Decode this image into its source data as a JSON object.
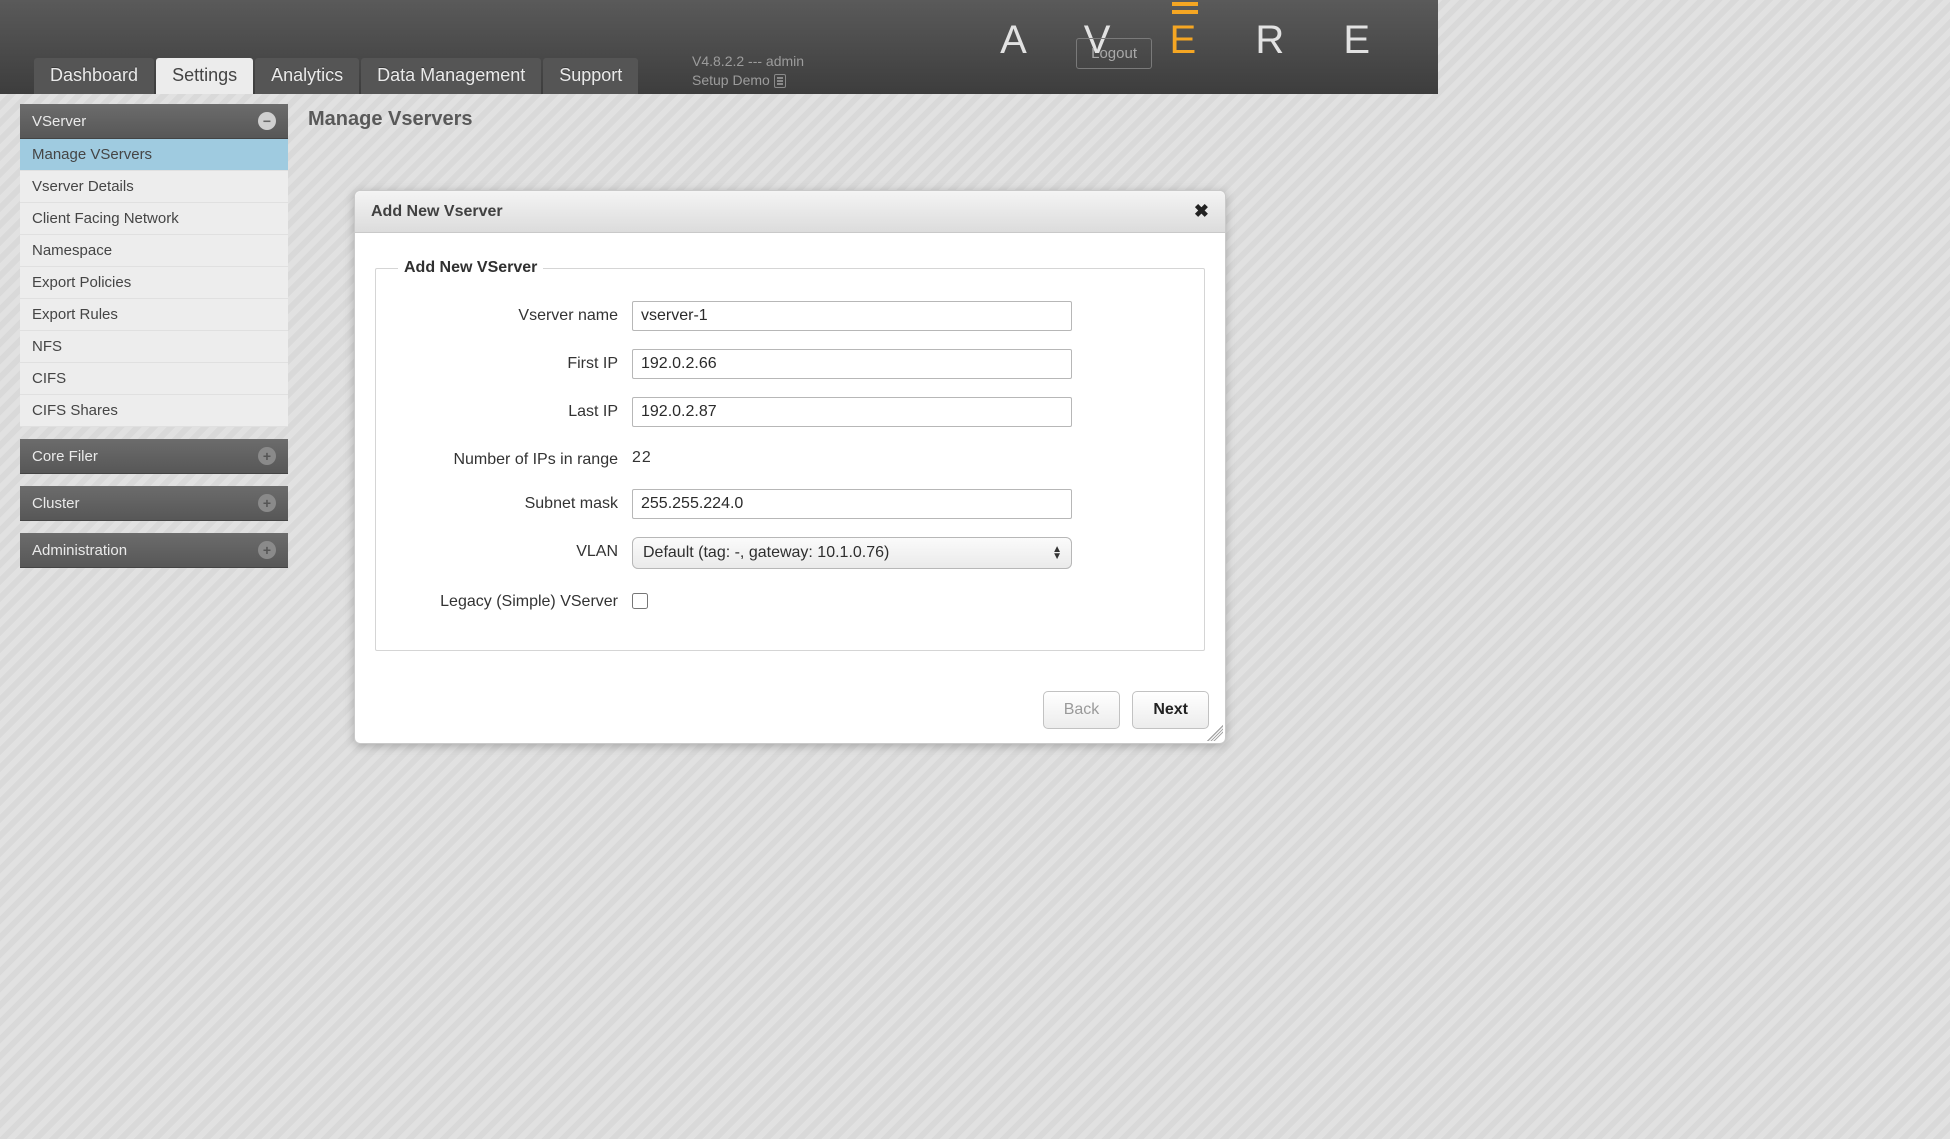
{
  "brand": "AVERE",
  "header": {
    "logout_label": "Logout",
    "version_line": "V4.8.2.2 --- admin",
    "setup_demo": "Setup Demo",
    "tabs": [
      {
        "label": "Dashboard",
        "active": false
      },
      {
        "label": "Settings",
        "active": true
      },
      {
        "label": "Analytics",
        "active": false
      },
      {
        "label": "Data Management",
        "active": false
      },
      {
        "label": "Support",
        "active": false
      }
    ]
  },
  "sidebar": {
    "sections": [
      {
        "title": "VServer",
        "icon": "minus",
        "items": [
          {
            "label": "Manage VServers",
            "active": true
          },
          {
            "label": "Vserver Details"
          },
          {
            "label": "Client Facing Network"
          },
          {
            "label": "Namespace"
          },
          {
            "label": "Export Policies"
          },
          {
            "label": "Export Rules"
          },
          {
            "label": "NFS"
          },
          {
            "label": "CIFS"
          },
          {
            "label": "CIFS Shares"
          }
        ]
      },
      {
        "title": "Core Filer",
        "icon": "plus",
        "items": []
      },
      {
        "title": "Cluster",
        "icon": "plus",
        "items": []
      },
      {
        "title": "Administration",
        "icon": "plus",
        "items": []
      }
    ]
  },
  "page_title": "Manage Vservers",
  "dialog": {
    "title": "Add New Vserver",
    "legend": "Add New VServer",
    "fields": {
      "vserver_name": {
        "label": "Vserver name",
        "value": "vserver-1"
      },
      "first_ip": {
        "label": "First IP",
        "value": "192.0.2.66"
      },
      "last_ip": {
        "label": "Last IP",
        "value": "192.0.2.87"
      },
      "ip_count": {
        "label": "Number of IPs in range",
        "value": "22"
      },
      "subnet_mask": {
        "label": "Subnet mask",
        "value": "255.255.224.0"
      },
      "vlan": {
        "label": "VLAN",
        "selected": "Default (tag: -, gateway: 10.1.0.76)"
      },
      "legacy": {
        "label": "Legacy (Simple) VServer",
        "checked": false
      }
    },
    "buttons": {
      "back": "Back",
      "next": "Next"
    }
  }
}
